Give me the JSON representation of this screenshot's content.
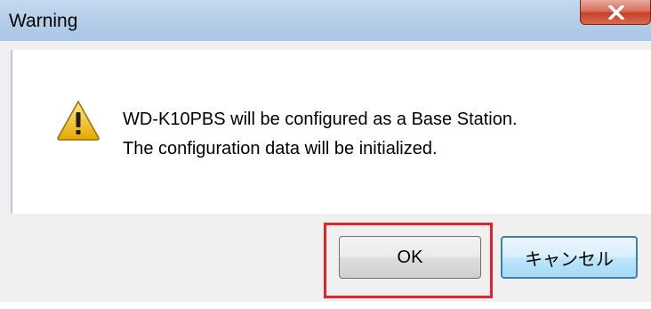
{
  "window": {
    "title": "Warning",
    "close_icon": "close-icon"
  },
  "message": {
    "icon": "warning-icon",
    "line1": "WD-K10PBS will be configured as a Base Station.",
    "line2": "The configuration data will be initialized."
  },
  "buttons": {
    "ok_label": "OK",
    "cancel_label": "キャンセル"
  },
  "colors": {
    "highlight": "#e0242b",
    "titlebar": "#b7cfe9",
    "close_button": "#c6432a"
  }
}
